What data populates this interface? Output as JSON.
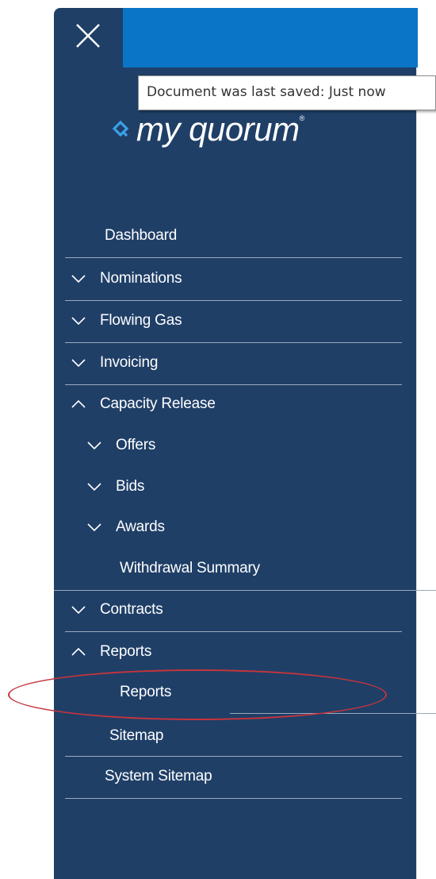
{
  "tooltip": {
    "text": "Document was last saved: Just now"
  },
  "brand": {
    "logo_text": "my quorum",
    "reg_mark": "®"
  },
  "nav": {
    "dashboard": "Dashboard",
    "nominations": "Nominations",
    "flowing_gas": "Flowing Gas",
    "invoicing": "Invoicing",
    "capacity_release": "Capacity Release",
    "offers": "Offers",
    "bids": "Bids",
    "awards": "Awards",
    "withdrawal_summary": "Withdrawal Summary",
    "contracts": "Contracts",
    "reports": "Reports",
    "reports_child": "Reports",
    "sitemap": "Sitemap",
    "system_sitemap": "System Sitemap"
  },
  "icons": [
    "close-icon",
    "quorum-logo-icon",
    "chevron-down-icon",
    "chevron-up-icon"
  ],
  "colors": {
    "sidebar": "#1f3f67",
    "topbar": "#0a74c7",
    "highlight": "#c6343c"
  }
}
